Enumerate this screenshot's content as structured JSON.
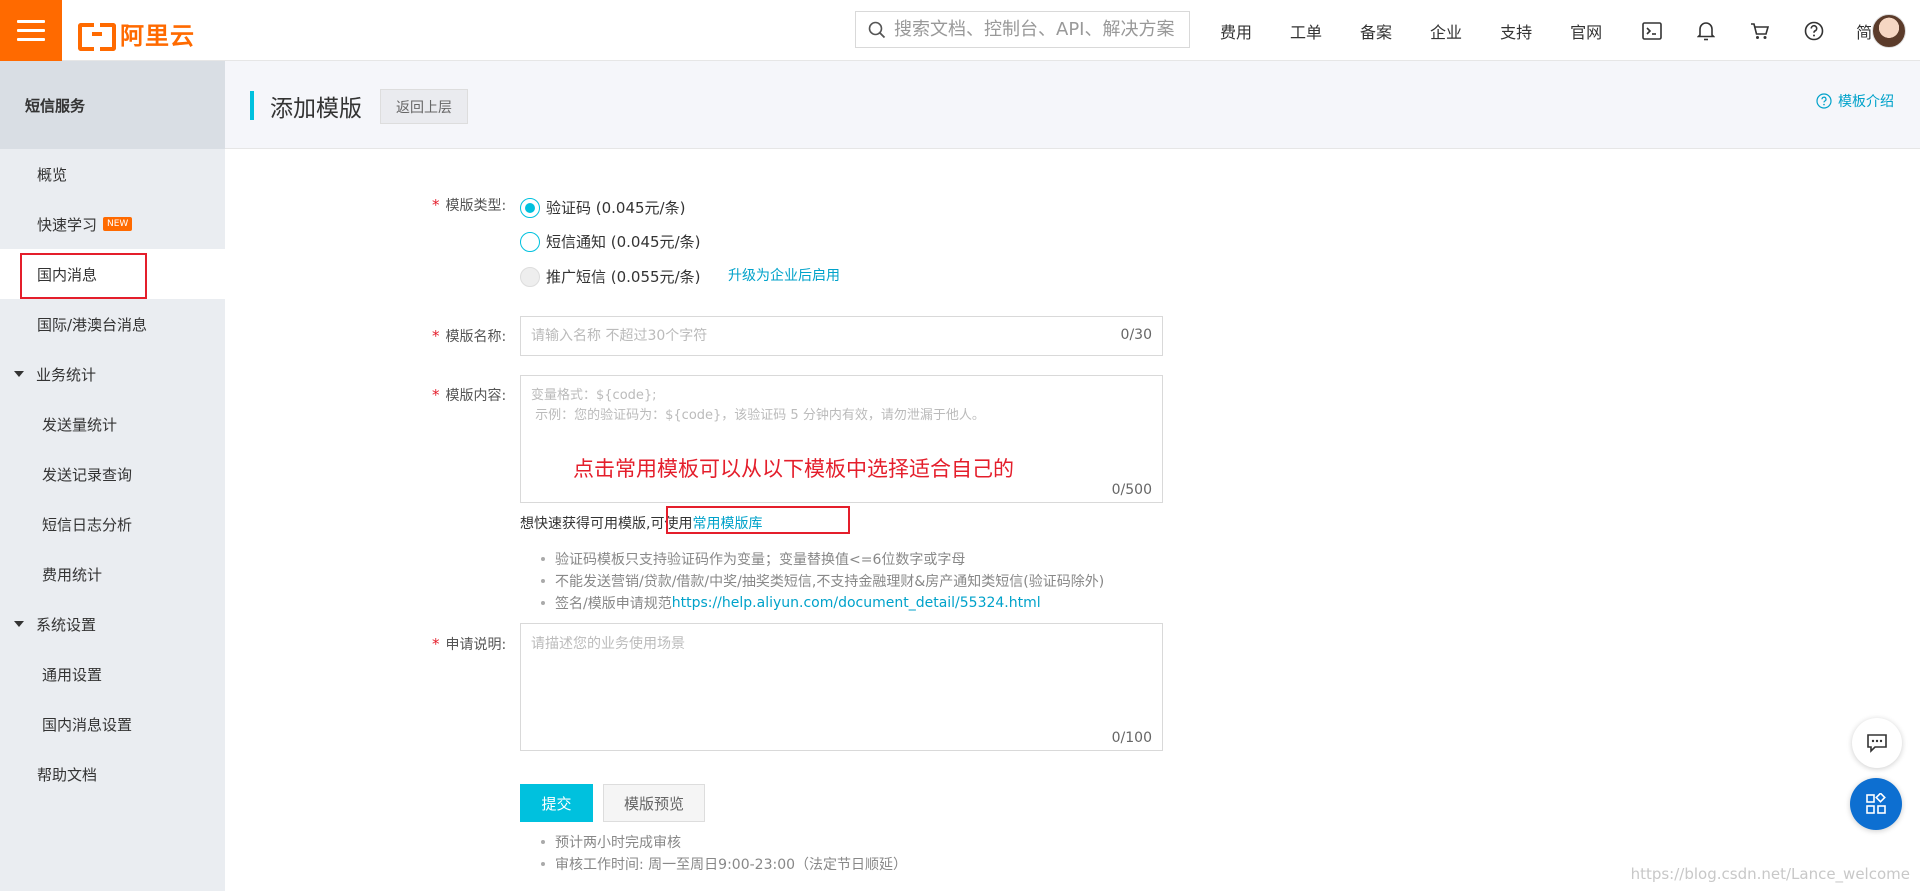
{
  "header": {
    "logo_text": "阿里云",
    "search_placeholder": "搜索文档、控制台、API、解决方案",
    "nav": [
      "费用",
      "工单",
      "备案",
      "企业",
      "支持",
      "官网"
    ],
    "lang": "简体",
    "icons": [
      "terminal-icon",
      "bell-icon",
      "cart-icon",
      "help-icon"
    ],
    "accent": "#ff6a00"
  },
  "sidebar": {
    "title": "短信服务",
    "items": [
      {
        "label": "概览"
      },
      {
        "label": "快速学习",
        "badge": "NEW"
      },
      {
        "label": "国内消息"
      },
      {
        "label": "国际/港澳台消息"
      },
      {
        "label": "业务统计"
      },
      {
        "label": "发送量统计"
      },
      {
        "label": "发送记录查询"
      },
      {
        "label": "短信日志分析"
      },
      {
        "label": "费用统计"
      },
      {
        "label": "系统设置"
      },
      {
        "label": "通用设置"
      },
      {
        "label": "国内消息设置"
      },
      {
        "label": "帮助文档"
      }
    ]
  },
  "page": {
    "title": "添加模版",
    "back_label": "返回上层",
    "help_label": "模板介绍",
    "accent": "#00c1de"
  },
  "form": {
    "type_label": "模版类型:",
    "type_options": [
      {
        "label": "验证码 (0.045元/条)",
        "selected": true
      },
      {
        "label": "短信通知 (0.045元/条)",
        "selected": false
      },
      {
        "label": "推广短信 (0.055元/条)",
        "selected": false,
        "disabled": true
      }
    ],
    "upgrade_link": "升级为企业后启用",
    "name_label": "模版名称:",
    "name_placeholder": "请输入名称 不超过30个字符",
    "name_counter": "0/30",
    "content_label": "模版内容:",
    "content_placeholder": "变量格式：${code};\n 示例：您的验证码为：${code}，该验证码 5 分钟内有效，请勿泄漏于他人。",
    "content_counter": "0/500",
    "annotation": "点击常用模板可以从以下模板中选择适合自己的",
    "quick_hint": "想快速获得可用模版,",
    "quick_use": "可使用",
    "quick_link": "常用模版库",
    "tips": [
      "验证码模板只支持验证码作为变量；变量替换值<=6位数字或字母",
      "不能发送营销/贷款/借款/中奖/抽奖类短信,不支持金融理财&房产通知类短信(验证码除外)",
      "签名/模版申请规范 "
    ],
    "tips_link": "https://help.aliyun.com/document_detail/55324.html",
    "desc_label": "申请说明:",
    "desc_placeholder": "请描述您的业务使用场景",
    "desc_counter": "0/100",
    "submit_label": "提交",
    "preview_label": "模版预览",
    "footer_tips": [
      "预计两小时完成审核",
      "审核工作时间: 周一至周日9:00-23:00（法定节日顺延）"
    ]
  },
  "watermark": "https://blog.csdn.net/Lance_welcome"
}
